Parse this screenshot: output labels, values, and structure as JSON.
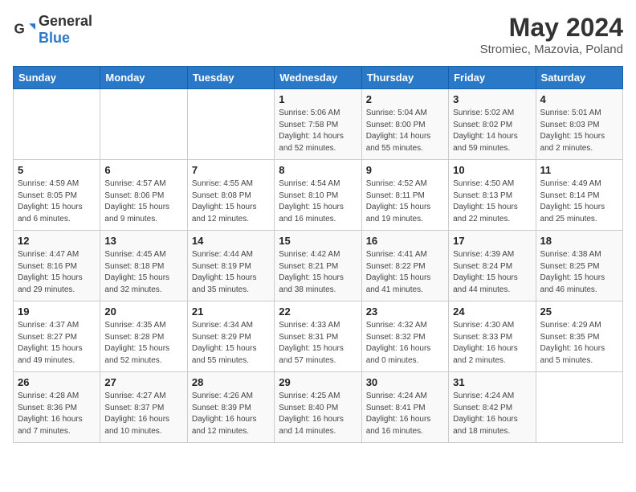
{
  "header": {
    "logo_general": "General",
    "logo_blue": "Blue",
    "month_year": "May 2024",
    "location": "Stromiec, Mazovia, Poland"
  },
  "days_of_week": [
    "Sunday",
    "Monday",
    "Tuesday",
    "Wednesday",
    "Thursday",
    "Friday",
    "Saturday"
  ],
  "weeks": [
    [
      {
        "day": "",
        "info": ""
      },
      {
        "day": "",
        "info": ""
      },
      {
        "day": "",
        "info": ""
      },
      {
        "day": "1",
        "info": "Sunrise: 5:06 AM\nSunset: 7:58 PM\nDaylight: 14 hours\nand 52 minutes."
      },
      {
        "day": "2",
        "info": "Sunrise: 5:04 AM\nSunset: 8:00 PM\nDaylight: 14 hours\nand 55 minutes."
      },
      {
        "day": "3",
        "info": "Sunrise: 5:02 AM\nSunset: 8:02 PM\nDaylight: 14 hours\nand 59 minutes."
      },
      {
        "day": "4",
        "info": "Sunrise: 5:01 AM\nSunset: 8:03 PM\nDaylight: 15 hours\nand 2 minutes."
      }
    ],
    [
      {
        "day": "5",
        "info": "Sunrise: 4:59 AM\nSunset: 8:05 PM\nDaylight: 15 hours\nand 6 minutes."
      },
      {
        "day": "6",
        "info": "Sunrise: 4:57 AM\nSunset: 8:06 PM\nDaylight: 15 hours\nand 9 minutes."
      },
      {
        "day": "7",
        "info": "Sunrise: 4:55 AM\nSunset: 8:08 PM\nDaylight: 15 hours\nand 12 minutes."
      },
      {
        "day": "8",
        "info": "Sunrise: 4:54 AM\nSunset: 8:10 PM\nDaylight: 15 hours\nand 16 minutes."
      },
      {
        "day": "9",
        "info": "Sunrise: 4:52 AM\nSunset: 8:11 PM\nDaylight: 15 hours\nand 19 minutes."
      },
      {
        "day": "10",
        "info": "Sunrise: 4:50 AM\nSunset: 8:13 PM\nDaylight: 15 hours\nand 22 minutes."
      },
      {
        "day": "11",
        "info": "Sunrise: 4:49 AM\nSunset: 8:14 PM\nDaylight: 15 hours\nand 25 minutes."
      }
    ],
    [
      {
        "day": "12",
        "info": "Sunrise: 4:47 AM\nSunset: 8:16 PM\nDaylight: 15 hours\nand 29 minutes."
      },
      {
        "day": "13",
        "info": "Sunrise: 4:45 AM\nSunset: 8:18 PM\nDaylight: 15 hours\nand 32 minutes."
      },
      {
        "day": "14",
        "info": "Sunrise: 4:44 AM\nSunset: 8:19 PM\nDaylight: 15 hours\nand 35 minutes."
      },
      {
        "day": "15",
        "info": "Sunrise: 4:42 AM\nSunset: 8:21 PM\nDaylight: 15 hours\nand 38 minutes."
      },
      {
        "day": "16",
        "info": "Sunrise: 4:41 AM\nSunset: 8:22 PM\nDaylight: 15 hours\nand 41 minutes."
      },
      {
        "day": "17",
        "info": "Sunrise: 4:39 AM\nSunset: 8:24 PM\nDaylight: 15 hours\nand 44 minutes."
      },
      {
        "day": "18",
        "info": "Sunrise: 4:38 AM\nSunset: 8:25 PM\nDaylight: 15 hours\nand 46 minutes."
      }
    ],
    [
      {
        "day": "19",
        "info": "Sunrise: 4:37 AM\nSunset: 8:27 PM\nDaylight: 15 hours\nand 49 minutes."
      },
      {
        "day": "20",
        "info": "Sunrise: 4:35 AM\nSunset: 8:28 PM\nDaylight: 15 hours\nand 52 minutes."
      },
      {
        "day": "21",
        "info": "Sunrise: 4:34 AM\nSunset: 8:29 PM\nDaylight: 15 hours\nand 55 minutes."
      },
      {
        "day": "22",
        "info": "Sunrise: 4:33 AM\nSunset: 8:31 PM\nDaylight: 15 hours\nand 57 minutes."
      },
      {
        "day": "23",
        "info": "Sunrise: 4:32 AM\nSunset: 8:32 PM\nDaylight: 16 hours\nand 0 minutes."
      },
      {
        "day": "24",
        "info": "Sunrise: 4:30 AM\nSunset: 8:33 PM\nDaylight: 16 hours\nand 2 minutes."
      },
      {
        "day": "25",
        "info": "Sunrise: 4:29 AM\nSunset: 8:35 PM\nDaylight: 16 hours\nand 5 minutes."
      }
    ],
    [
      {
        "day": "26",
        "info": "Sunrise: 4:28 AM\nSunset: 8:36 PM\nDaylight: 16 hours\nand 7 minutes."
      },
      {
        "day": "27",
        "info": "Sunrise: 4:27 AM\nSunset: 8:37 PM\nDaylight: 16 hours\nand 10 minutes."
      },
      {
        "day": "28",
        "info": "Sunrise: 4:26 AM\nSunset: 8:39 PM\nDaylight: 16 hours\nand 12 minutes."
      },
      {
        "day": "29",
        "info": "Sunrise: 4:25 AM\nSunset: 8:40 PM\nDaylight: 16 hours\nand 14 minutes."
      },
      {
        "day": "30",
        "info": "Sunrise: 4:24 AM\nSunset: 8:41 PM\nDaylight: 16 hours\nand 16 minutes."
      },
      {
        "day": "31",
        "info": "Sunrise: 4:24 AM\nSunset: 8:42 PM\nDaylight: 16 hours\nand 18 minutes."
      },
      {
        "day": "",
        "info": ""
      }
    ]
  ]
}
